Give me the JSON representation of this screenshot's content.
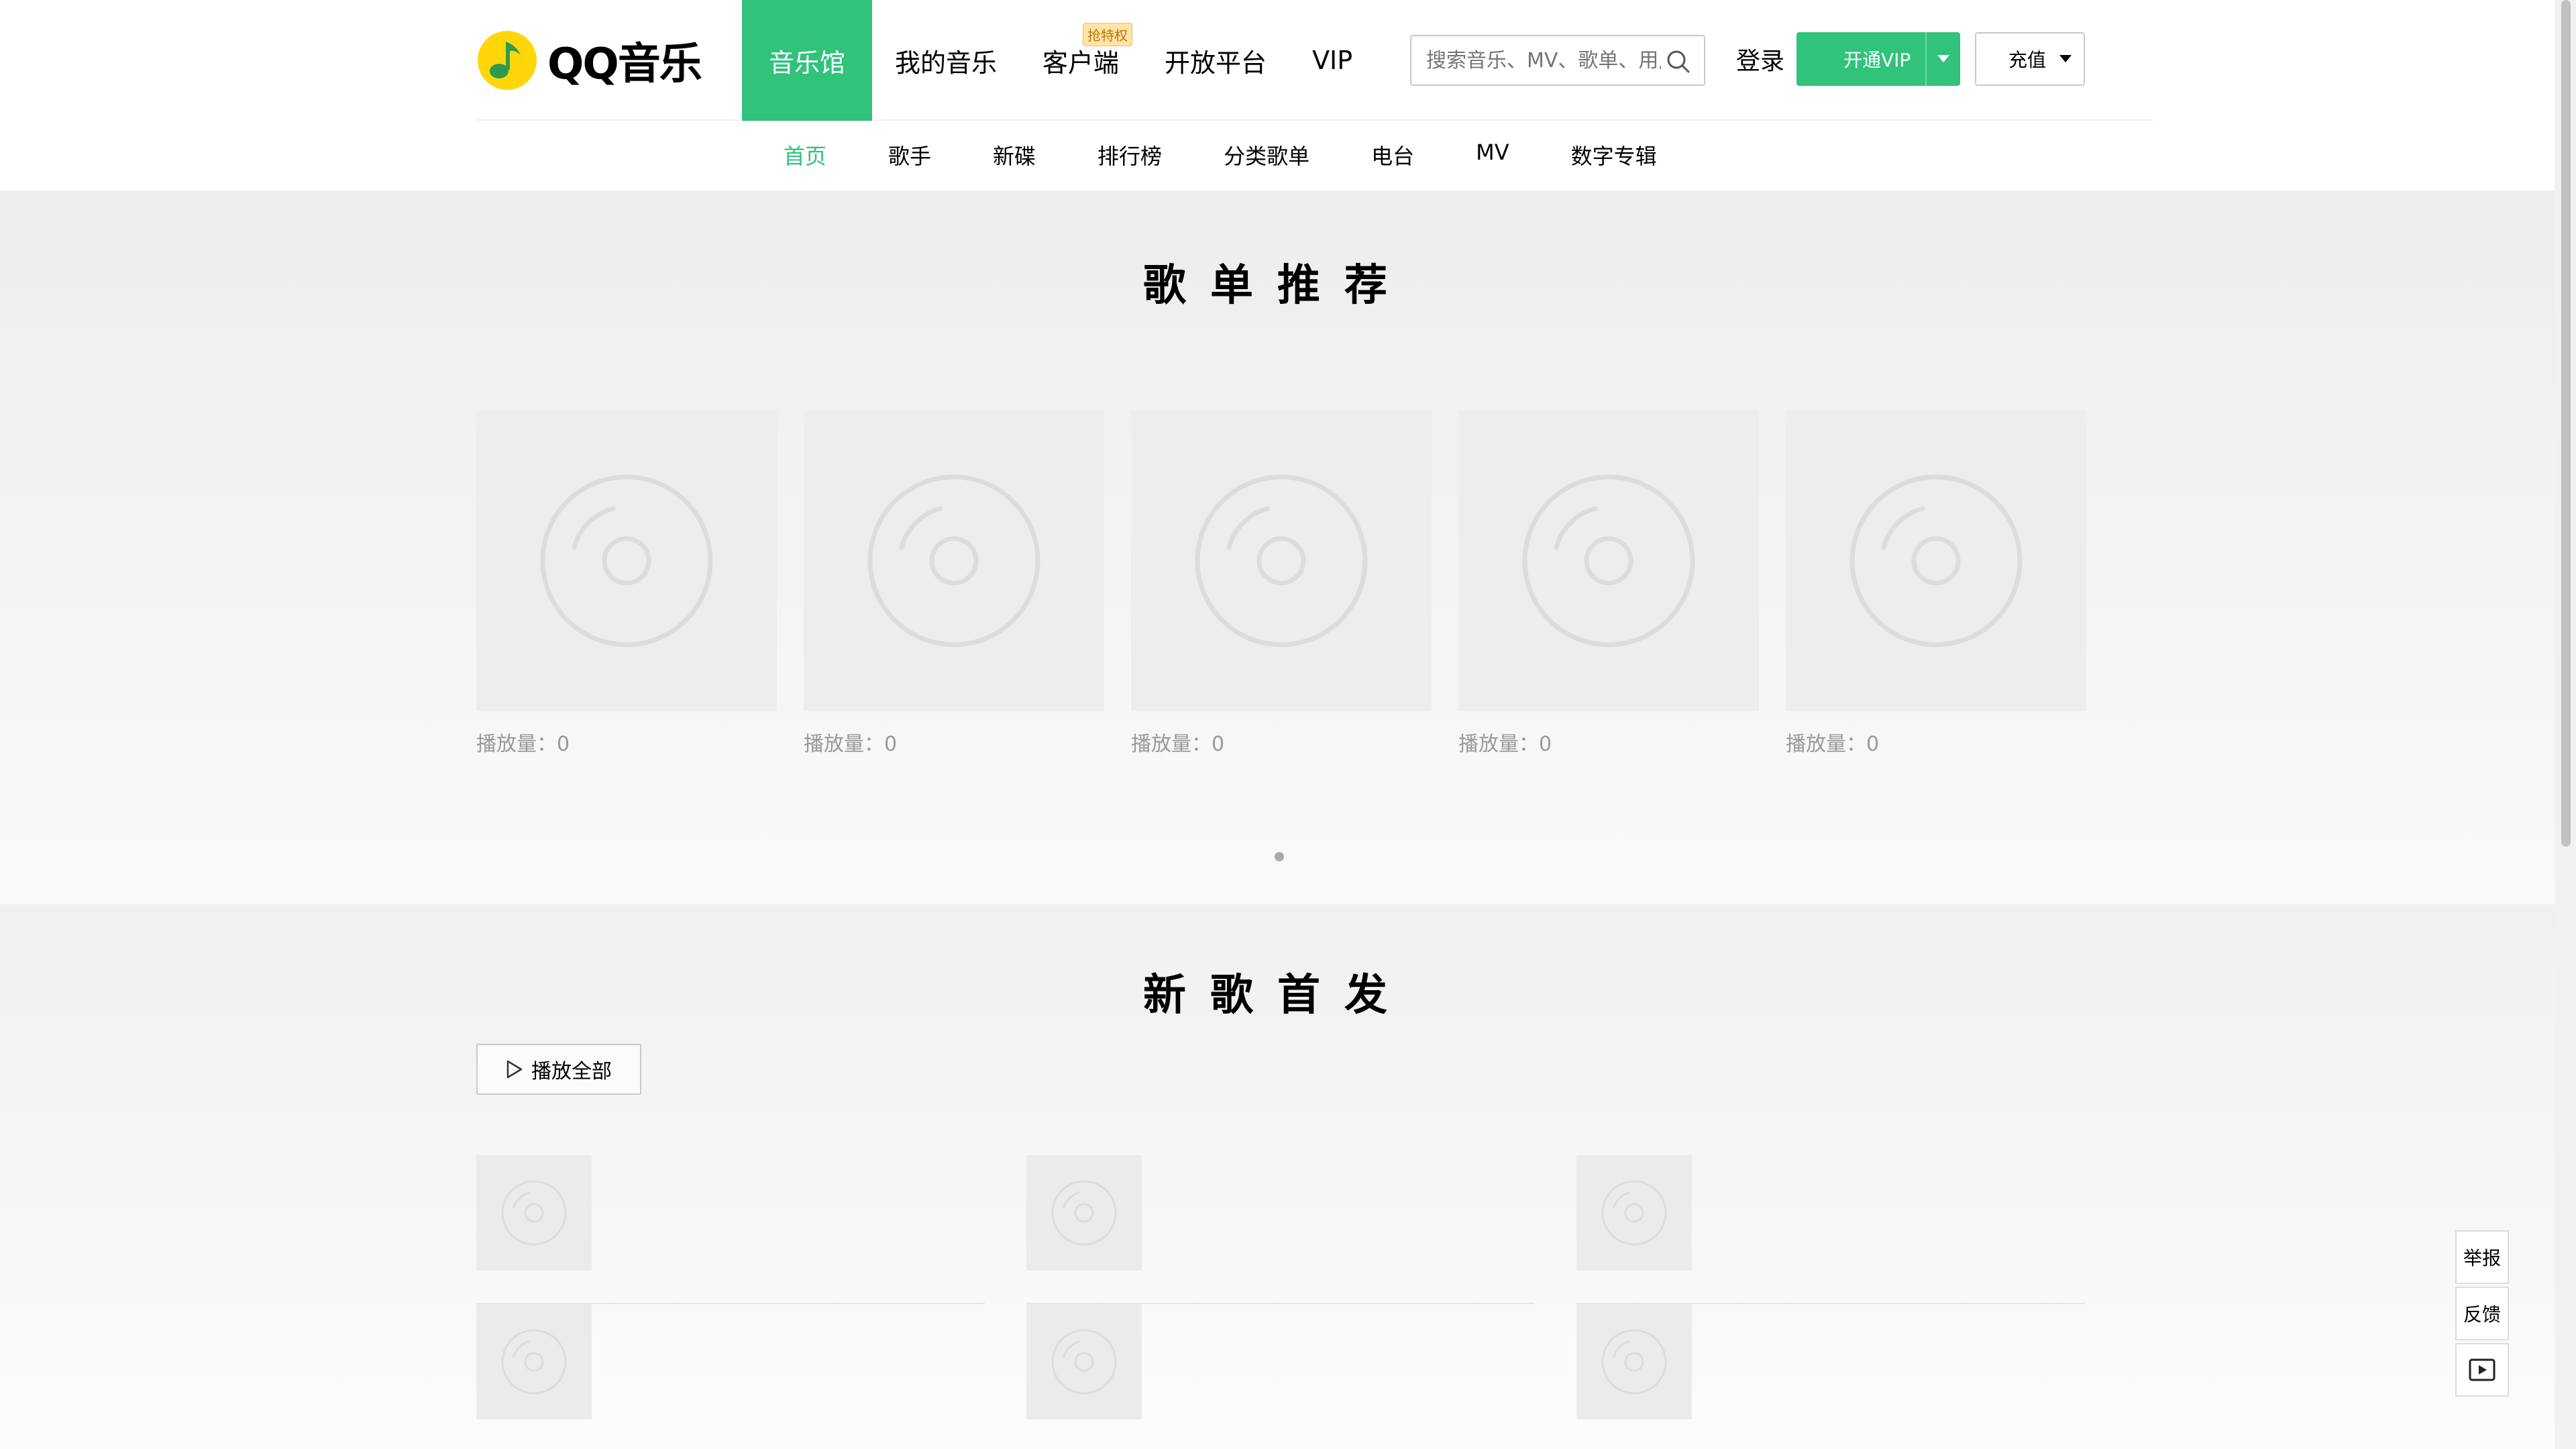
{
  "brand": {
    "name": "QQ音乐",
    "logo_icon": "qq-music-logo-icon",
    "accent": "#31c27c",
    "logo_yellow": "#ffd60a"
  },
  "top_nav": [
    {
      "label": "音乐馆",
      "active": true
    },
    {
      "label": "我的音乐"
    },
    {
      "label": "客户端",
      "badge": "抢特权"
    },
    {
      "label": "开放平台"
    },
    {
      "label": "VIP"
    }
  ],
  "search": {
    "placeholder": "搜索音乐、MV、歌单、用户",
    "icon": "search-icon"
  },
  "login_label": "登录",
  "vip_button_label": "开通VIP",
  "charge_button_label": "充值",
  "sub_nav": [
    {
      "label": "首页",
      "active": true
    },
    {
      "label": "歌手"
    },
    {
      "label": "新碟"
    },
    {
      "label": "排行榜"
    },
    {
      "label": "分类歌单"
    },
    {
      "label": "电台"
    },
    {
      "label": "MV"
    },
    {
      "label": "数字专辑"
    }
  ],
  "playlist_section": {
    "title": "歌单推荐",
    "cards": [
      {
        "play_count": "播放量：0"
      },
      {
        "play_count": "播放量：0"
      },
      {
        "play_count": "播放量：0"
      },
      {
        "play_count": "播放量：0"
      },
      {
        "play_count": "播放量：0"
      }
    ]
  },
  "new_songs_section": {
    "title": "新歌首发",
    "play_all_label": "播放全部"
  },
  "side_tools": {
    "report_label": "举报",
    "feedback_label": "反馈",
    "video_icon": "video-play-icon"
  }
}
